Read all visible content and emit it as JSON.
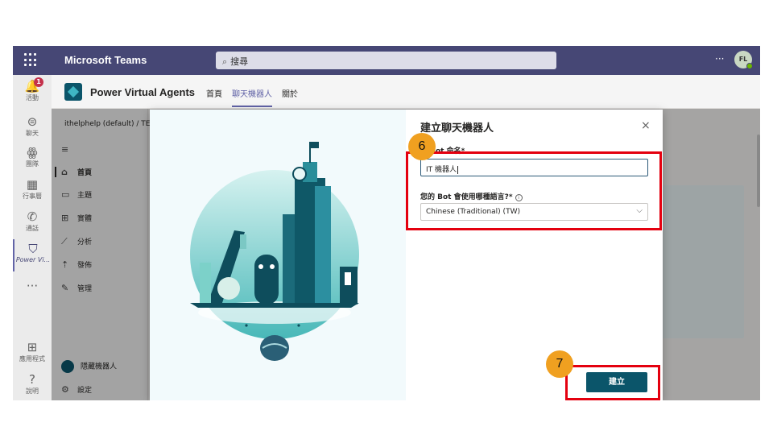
{
  "topbar": {
    "app_name": "Microsoft Teams",
    "search_placeholder": "搜尋",
    "more": "···",
    "avatar_initials": "FL"
  },
  "rail": [
    {
      "label": "活動",
      "icon": "bell-icon",
      "glyph": "🔔",
      "badge": "1"
    },
    {
      "label": "聊天",
      "icon": "chat-icon",
      "glyph": "⊜"
    },
    {
      "label": "團隊",
      "icon": "teams-icon",
      "glyph": "ꙮ"
    },
    {
      "label": "行事曆",
      "icon": "calendar-icon",
      "glyph": "▦"
    },
    {
      "label": "通話",
      "icon": "phone-icon",
      "glyph": "✆"
    },
    {
      "label": "Power Vi...",
      "icon": "power-virtual-agents-icon",
      "glyph": "⛉"
    },
    {
      "label": "",
      "icon": "more-apps-icon",
      "glyph": "···"
    },
    {
      "label": "應用程式",
      "icon": "apps-icon",
      "glyph": "⊞"
    },
    {
      "label": "說明",
      "icon": "help-icon",
      "glyph": "?"
    }
  ],
  "app_header": {
    "name": "Power Virtual Agents",
    "tabs": [
      "首頁",
      "聊天機器人",
      "關於"
    ],
    "active_tab": 1
  },
  "leftnav": {
    "breadcrumb": "ithelphelp (default) / TE",
    "items": [
      {
        "label": "",
        "glyph": "≡"
      },
      {
        "label": "首頁",
        "glyph": "⌂"
      },
      {
        "label": "主題",
        "glyph": "▭"
      },
      {
        "label": "實體",
        "glyph": "⊞"
      },
      {
        "label": "分析",
        "glyph": "⟋"
      },
      {
        "label": "發佈",
        "glyph": "⇡"
      },
      {
        "label": "管理",
        "glyph": "✎"
      }
    ],
    "bottom": [
      {
        "label": "隱藏機器人"
      },
      {
        "label": "設定",
        "glyph": "⚙"
      }
    ]
  },
  "dialog": {
    "title": "建立聊天機器人",
    "name_label": "為 Bot 命名*",
    "name_value": "IT 機器人",
    "language_label": "您的 Bot 會使用哪種語言?*",
    "language_value": "Chinese (Traditional) (TW)",
    "create_button": "建立",
    "close": "×"
  },
  "annotations": {
    "step_a": "6",
    "step_b": "7"
  },
  "colors": {
    "teams_bar": "#464775",
    "accent": "#6264a7",
    "pva_primary": "#0b556a",
    "highlight": "#e4000f",
    "step_badge": "#f0a020"
  }
}
